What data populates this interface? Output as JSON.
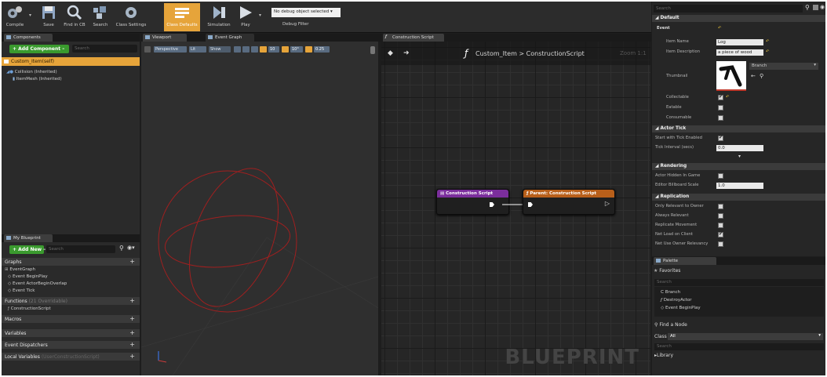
{
  "toolbar": {
    "buttons": [
      {
        "label": "Compile",
        "icon": "compile-icon"
      },
      {
        "label": "Save",
        "icon": "save-icon"
      },
      {
        "label": "Find in CB",
        "icon": "find-in-cb-icon"
      },
      {
        "label": "Search",
        "icon": "search-icon"
      },
      {
        "label": "Class Settings",
        "icon": "class-settings-icon"
      },
      {
        "label": "Class Defaults",
        "icon": "class-defaults-icon"
      },
      {
        "label": "Simulation",
        "icon": "simulation-icon"
      },
      {
        "label": "Play",
        "icon": "play-icon"
      }
    ],
    "debug_select": "No debug object selected ▾",
    "debug_filter": "Debug Filter"
  },
  "components": {
    "tab": "Components",
    "add_button": "+ Add Component –",
    "search_placeholder": "Search",
    "self_item": "Custom_Item(self)",
    "items": [
      "Collision (Inherited)",
      "ItemMesh (Inherited)"
    ]
  },
  "my_blueprint": {
    "tab": "My Blueprint",
    "add_new": "+ Add New –",
    "search_placeholder": "Search",
    "graphs_label": "Graphs",
    "event_graph": "EventGraph",
    "events": [
      "Event BeginPlay",
      "Event ActorBeginOverlap",
      "Event Tick"
    ],
    "functions_label": "Functions",
    "functions_hint": "(21 Overridable)",
    "construction_script": "ConstructionScript",
    "macros": "Macros",
    "variables": "Variables",
    "dispatchers": "Event Dispatchers",
    "local_vars": "Local Variables",
    "local_vars_hint": "(UserConstructionScript)"
  },
  "viewport": {
    "tab": "Viewport",
    "event_graph_tab": "Event Graph",
    "perspective": "Perspective",
    "lit": "Lit",
    "show": "Show",
    "snap_grid": "10",
    "snap_rot": "10°",
    "snap_scale": "0.25"
  },
  "graph": {
    "tab": "Construction Script",
    "breadcrumb_fn": "Custom_Item",
    "breadcrumb_sep": ">",
    "breadcrumb_script": "ConstructionScript",
    "zoom": "Zoom 1:1",
    "watermark": "BLUEPRINT",
    "node1_title": "Construction Script",
    "node2_title": "Parent: Construction Script",
    "node1_color": "#7b2e9c",
    "node2_color": "#b85f1a"
  },
  "details": {
    "search_placeholder": "Search",
    "default_section": "Default",
    "event_sub": "Event",
    "item_name_label": "Item Name",
    "item_name_value": "Log",
    "item_desc_label": "Item Description",
    "item_desc_value": "a piece of wood",
    "thumbnail_label": "Thumbnail",
    "thumbnail_select": "Branch",
    "collectable_label": "Collectable",
    "collectable": true,
    "eatable_label": "Eatable",
    "eatable": false,
    "consumable_label": "Consumable",
    "consumable": false,
    "actor_tick_section": "Actor Tick",
    "start_tick_label": "Start with Tick Enabled",
    "start_tick": true,
    "tick_interval_label": "Tick Interval (secs)",
    "tick_interval_value": "0.0",
    "rendering_section": "Rendering",
    "hidden_label": "Actor Hidden In Game",
    "hidden": false,
    "billboard_label": "Editor Billboard Scale",
    "billboard_value": "1.0",
    "replication_section": "Replication",
    "rep_rows": [
      {
        "label": "Only Relevant to Owner",
        "checked": false
      },
      {
        "label": "Always Relevant",
        "checked": false
      },
      {
        "label": "Replicate Movement",
        "checked": false
      },
      {
        "label": "Net Load on Client",
        "checked": true
      },
      {
        "label": "Net Use Owner Relevancy",
        "checked": false
      }
    ]
  },
  "palette": {
    "tab": "Palette",
    "favorites": "Favorites",
    "search_placeholder": "Search",
    "items": [
      "Branch",
      "DestroyActor",
      "Event BeginPlay"
    ],
    "find_node": "Find a Node",
    "class_label": "Class",
    "class_value": "All",
    "search2_placeholder": "Search",
    "library": "Library"
  }
}
